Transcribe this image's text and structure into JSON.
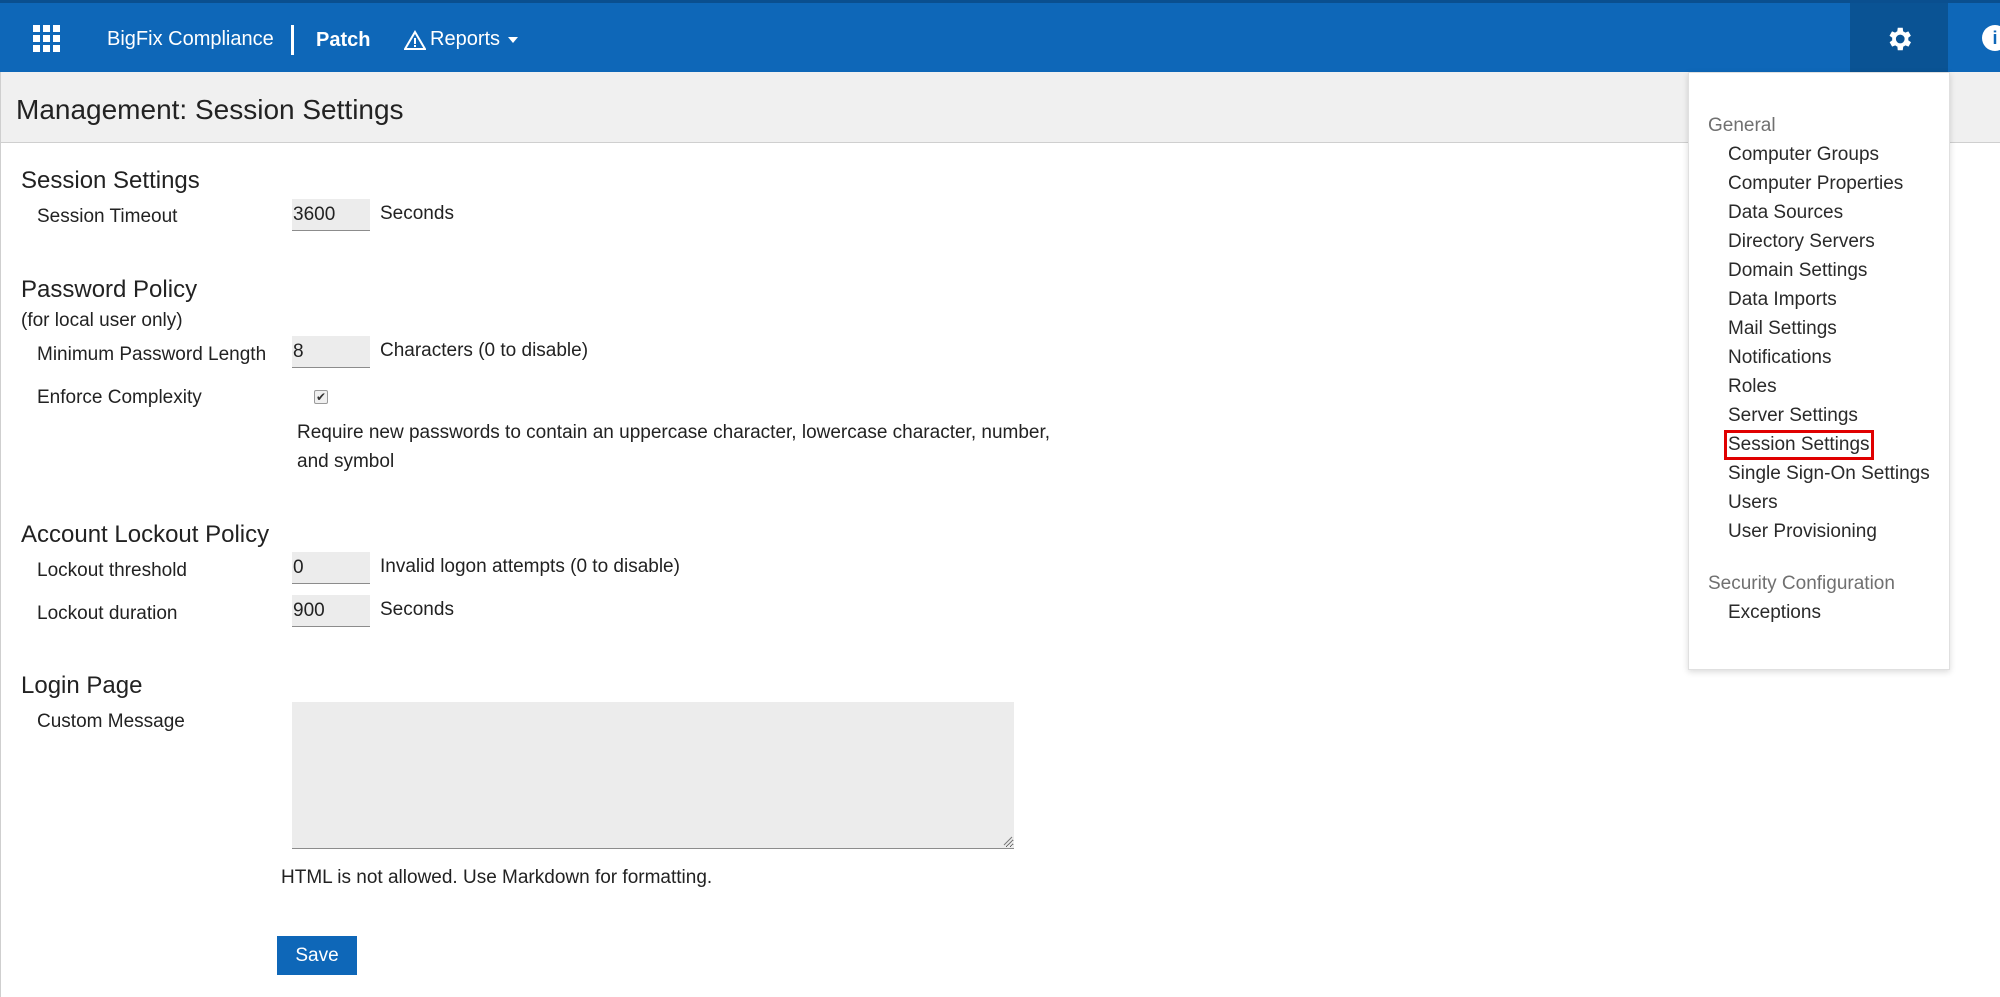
{
  "topbar": {
    "brand": "BigFix Compliance",
    "patch": "Patch",
    "reports": "Reports",
    "info": "i"
  },
  "page": {
    "title": "Management: Session Settings"
  },
  "session": {
    "title": "Session Settings",
    "timeout_label": "Session Timeout",
    "timeout_value": "3600",
    "timeout_unit": "Seconds"
  },
  "password": {
    "title": "Password Policy",
    "note": "(for local user only)",
    "min_length_label": "Minimum Password Length",
    "min_length_value": "8",
    "min_length_unit": "Characters (0 to disable)",
    "complexity_label": "Enforce Complexity",
    "complexity_checked": true,
    "complexity_help": "Require new passwords to contain an uppercase character, lowercase character, number, and symbol"
  },
  "lockout": {
    "title": "Account Lockout Policy",
    "threshold_label": "Lockout threshold",
    "threshold_value": "0",
    "threshold_unit": "Invalid logon attempts (0 to disable)",
    "duration_label": "Lockout duration",
    "duration_value": "900",
    "duration_unit": "Seconds"
  },
  "login": {
    "title": "Login Page",
    "custom_label": "Custom Message",
    "custom_value": "",
    "note": "HTML is not allowed. Use Markdown for formatting."
  },
  "actions": {
    "save": "Save"
  },
  "menu": {
    "general_label": "General",
    "general_items": [
      "Computer Groups",
      "Computer Properties",
      "Data Sources",
      "Directory Servers",
      "Domain Settings",
      "Data Imports",
      "Mail Settings",
      "Notifications",
      "Roles",
      "Server Settings",
      "Session Settings",
      "Single Sign-On Settings",
      "Users",
      "User Provisioning"
    ],
    "active_item": "Session Settings",
    "security_label": "Security Configuration",
    "security_items": [
      "Exceptions"
    ]
  },
  "colors": {
    "topbar": "#0e67b8",
    "gear_box": "#0a5394",
    "highlight": "#e00000"
  },
  "icons": {
    "apps": "apps-grid-icon",
    "reports": "warning-triangle-icon",
    "settings": "gear-icon",
    "info": "info-icon"
  }
}
